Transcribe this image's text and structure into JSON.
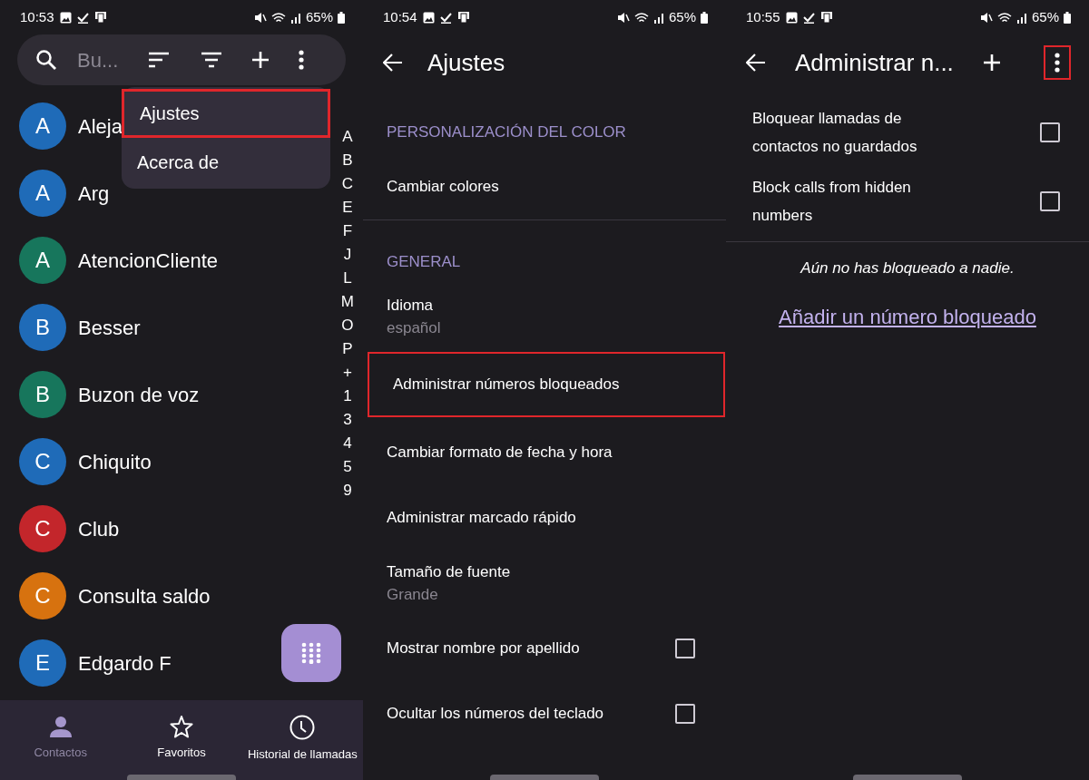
{
  "contacts_screen": {
    "status_bar": {
      "time": "10:53",
      "battery": "65%"
    },
    "search": {
      "placeholder": "Bu..."
    },
    "menu": [
      {
        "label": "Ajustes",
        "highlighted": true
      },
      {
        "label": "Acerca de",
        "highlighted": false
      }
    ],
    "contacts": [
      {
        "initial": "A",
        "name": "Aleja",
        "color": "#1f6bb8"
      },
      {
        "initial": "A",
        "name": "Arg",
        "color": "#1f6bb8"
      },
      {
        "initial": "A",
        "name": "AtencionCliente",
        "color": "#17765c"
      },
      {
        "initial": "B",
        "name": "Besser",
        "color": "#1f6bb8"
      },
      {
        "initial": "B",
        "name": "Buzon de voz",
        "color": "#17765c"
      },
      {
        "initial": "C",
        "name": "Chiquito",
        "color": "#1f6bb8"
      },
      {
        "initial": "C",
        "name": "Club",
        "color": "#c3262b"
      },
      {
        "initial": "C",
        "name": "Consulta saldo",
        "color": "#d7720f"
      },
      {
        "initial": "E",
        "name": "Edgardo F",
        "color": "#1f6bb8"
      }
    ],
    "index_letters": [
      "A",
      "B",
      "C",
      "E",
      "F",
      "J",
      "L",
      "M",
      "O",
      "P",
      "+",
      "1",
      "3",
      "4",
      "5",
      "9"
    ],
    "tabs": [
      {
        "label": "Contactos",
        "kind": "person",
        "selected": true
      },
      {
        "label": "Favoritos",
        "kind": "star",
        "selected": false
      },
      {
        "label": "Historial de llamadas",
        "kind": "clock",
        "selected": false
      }
    ]
  },
  "settings_screen": {
    "status_bar": {
      "time": "10:54",
      "battery": "65%"
    },
    "title": "Ajustes",
    "sections": [
      {
        "header": "PERSONALIZACIÓN DEL COLOR",
        "items": [
          {
            "title": "Cambiar colores",
            "kind": "link",
            "highlighted": false
          }
        ]
      },
      {
        "header": "GENERAL",
        "items": [
          {
            "title": "Idioma",
            "subtitle": "español",
            "kind": "value",
            "highlighted": false
          },
          {
            "title": "Administrar números bloqueados",
            "kind": "link",
            "highlighted": true
          },
          {
            "title": "Cambiar formato de fecha y hora",
            "kind": "link",
            "highlighted": false
          },
          {
            "title": "Administrar marcado rápido",
            "kind": "link",
            "highlighted": false
          },
          {
            "title": "Tamaño de fuente",
            "subtitle": "Grande",
            "kind": "value",
            "highlighted": false
          },
          {
            "title": "Mostrar nombre por apellido",
            "kind": "checkbox",
            "checked": false,
            "highlighted": false
          },
          {
            "title": "Ocultar los números del teclado",
            "kind": "checkbox",
            "checked": false,
            "highlighted": false
          }
        ]
      }
    ]
  },
  "blocked_screen": {
    "status_bar": {
      "time": "10:55",
      "battery": "65%"
    },
    "title": "Administrar n...",
    "more_highlighted": true,
    "options": [
      {
        "title": "Bloquear llamadas de contactos no guardados",
        "checked": false
      },
      {
        "title": "Block calls from hidden numbers",
        "checked": false
      }
    ],
    "empty_message": "Aún no has bloqueado a nadie.",
    "add_link": "Añadir un número bloqueado"
  }
}
